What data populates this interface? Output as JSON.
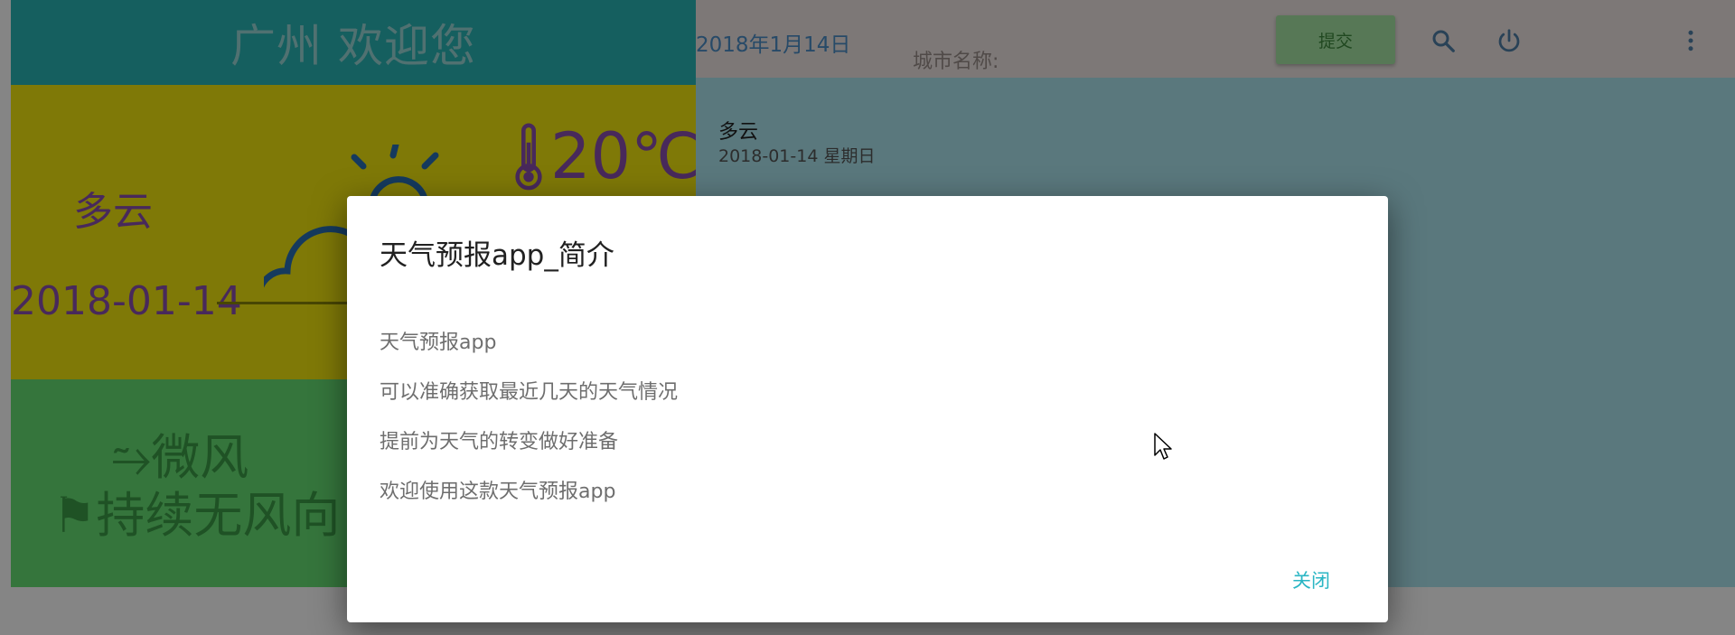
{
  "app": {
    "city_welcome": "广州 欢迎您",
    "top_date": "2018年1月14日",
    "city_label": "城市名称:",
    "submit_label": "提交",
    "icons": [
      "search-icon",
      "power-icon",
      "more-vert-icon"
    ]
  },
  "weather_card": {
    "condition": "多云",
    "date": "2018-01-14",
    "temperature": "20℃",
    "icon": "partly-cloudy-icon"
  },
  "wind_card": {
    "line1": "微风",
    "line2": "持续无风向"
  },
  "detail": {
    "condition": "多云",
    "date": "2018-01-14 星期日"
  },
  "dialog": {
    "title": "天气预报app_简介",
    "lines": [
      "天气预报app",
      "可以准确获取最近几天的天气情况",
      "提前为天气的转变做好准备",
      "欢迎使用这款天气预报app"
    ],
    "close_label": "关闭"
  },
  "colors": {
    "header": "#2ab6b6",
    "weather_card": "#f4e90f",
    "wind_card": "#66e174",
    "detail_panel": "#ace7f0",
    "accent_text": "#8b4fae",
    "dialog_button": "#2ab6c4"
  }
}
